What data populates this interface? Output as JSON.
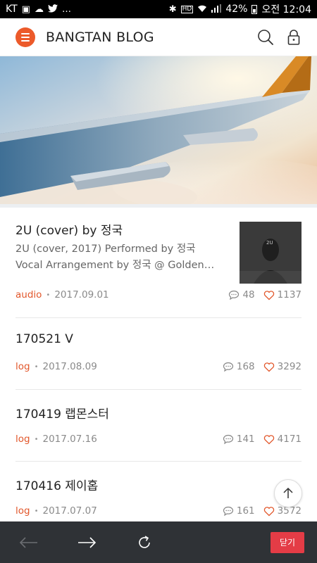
{
  "status_bar": {
    "carrier": "KT",
    "battery": "42%",
    "time": "오전 12:04"
  },
  "header": {
    "title": "BANGTAN BLOG"
  },
  "posts": [
    {
      "title": "2U (cover) by 정국",
      "excerpt_line1": "2U (cover, 2017) Performed by 정국",
      "excerpt_line2": "Vocal Arrangement by 정국 @ Golden…",
      "category": "audio",
      "date": "2017.09.01",
      "comments": "48",
      "likes": "1137",
      "thumb_text": "2U"
    },
    {
      "title": "170521 V",
      "category": "log",
      "date": "2017.08.09",
      "comments": "168",
      "likes": "3292"
    },
    {
      "title": "170419 랩몬스터",
      "category": "log",
      "date": "2017.07.16",
      "comments": "141",
      "likes": "4171"
    },
    {
      "title": "170416 제이홉",
      "category": "log",
      "date": "2017.07.07",
      "comments": "161",
      "likes": "3572"
    }
  ],
  "bottom_bar": {
    "close_label": "닫기"
  },
  "colors": {
    "accent": "#ec5a2a",
    "category": "#e2572b",
    "close": "#e43c46",
    "bar": "#2f3236"
  }
}
